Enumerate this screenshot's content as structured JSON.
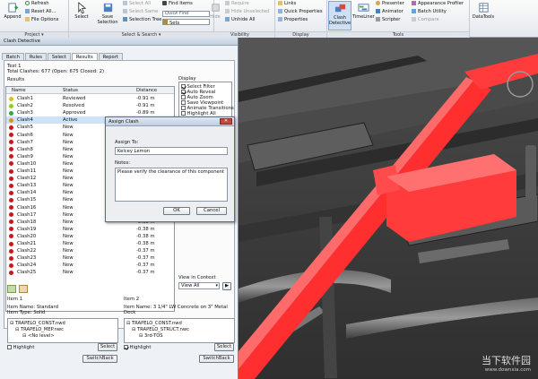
{
  "ribbon": {
    "project": {
      "label": "Project ▾",
      "append": "Append",
      "refresh": "Refresh",
      "reset_all": "Reset All...",
      "file_options": "File Options"
    },
    "select_search": {
      "label": "Select & Search ▾",
      "select": "Select",
      "save_selection": "Save Selection",
      "select_all": "Select All",
      "select_same": "Select Same",
      "selection_tree": "Selection Tree",
      "find_items": "Find Items",
      "quick_find_placeholder": "Quick Find",
      "sets": "Sets"
    },
    "visibility": {
      "label": "Visibility",
      "hide": "Hide",
      "require": "Require",
      "hide_unselected": "Hide Unselected",
      "unhide_all": "Unhide All"
    },
    "display": {
      "label": "Display",
      "links": "Links",
      "quick_properties": "Quick Properties",
      "properties": "Properties"
    },
    "tools": {
      "label": "Tools",
      "clash_detective": "Clash Detective",
      "timeliner": "TimeLiner",
      "presenter": "Presenter",
      "animator": "Animator",
      "scripter": "Scripter",
      "appearance_profiler": "Appearance Profiler",
      "batch_utility": "Batch Utility",
      "compare": "Compare",
      "datatools": "DataTools"
    }
  },
  "clash": {
    "window_title": "Clash Detective",
    "tabs": [
      "Batch",
      "Rules",
      "Select",
      "Results",
      "Report"
    ],
    "test_name": "Test 1",
    "summary": "Total Clashes: 677 (Open: 675  Closed: 2)",
    "results_label": "Results",
    "columns": {
      "name": "Name",
      "status": "Status",
      "distance": "Distance"
    },
    "rows": [
      {
        "name": "Clash1",
        "status": "Reviewed",
        "distance": "-0.91 m",
        "color": "#d9c21d"
      },
      {
        "name": "Clash2",
        "status": "Resolved",
        "distance": "-0.91 m",
        "color": "#8fcc2a"
      },
      {
        "name": "Clash3",
        "status": "Approved",
        "distance": "-0.89 m",
        "color": "#32a84a"
      },
      {
        "name": "Clash4",
        "status": "Active",
        "distance": "",
        "color": "#e09028"
      },
      {
        "name": "Clash5",
        "status": "New",
        "distance": "",
        "color": "#c8171a"
      },
      {
        "name": "Clash6",
        "status": "New",
        "distance": "",
        "color": "#c8171a"
      },
      {
        "name": "Clash7",
        "status": "New",
        "distance": "",
        "color": "#c8171a"
      },
      {
        "name": "Clash8",
        "status": "New",
        "distance": "",
        "color": "#c8171a"
      },
      {
        "name": "Clash9",
        "status": "New",
        "distance": "",
        "color": "#c8171a"
      },
      {
        "name": "Clash10",
        "status": "New",
        "distance": "",
        "color": "#c8171a"
      },
      {
        "name": "Clash11",
        "status": "New",
        "distance": "",
        "color": "#c8171a"
      },
      {
        "name": "Clash12",
        "status": "New",
        "distance": "",
        "color": "#c8171a"
      },
      {
        "name": "Clash13",
        "status": "New",
        "distance": "",
        "color": "#c8171a"
      },
      {
        "name": "Clash14",
        "status": "New",
        "distance": "",
        "color": "#c8171a"
      },
      {
        "name": "Clash15",
        "status": "New",
        "distance": "",
        "color": "#c8171a"
      },
      {
        "name": "Clash16",
        "status": "New",
        "distance": "",
        "color": "#c8171a"
      },
      {
        "name": "Clash17",
        "status": "New",
        "distance": "",
        "color": "#c8171a"
      },
      {
        "name": "Clash18",
        "status": "New",
        "distance": "-0.38 m",
        "color": "#c8171a"
      },
      {
        "name": "Clash19",
        "status": "New",
        "distance": "-0.38 m",
        "color": "#c8171a"
      },
      {
        "name": "Clash20",
        "status": "New",
        "distance": "-0.38 m",
        "color": "#c8171a"
      },
      {
        "name": "Clash21",
        "status": "New",
        "distance": "-0.38 m",
        "color": "#c8171a"
      },
      {
        "name": "Clash22",
        "status": "New",
        "distance": "-0.37 m",
        "color": "#c8171a"
      },
      {
        "name": "Clash23",
        "status": "New",
        "distance": "-0.37 m",
        "color": "#c8171a"
      },
      {
        "name": "Clash24",
        "status": "New",
        "distance": "-0.37 m",
        "color": "#c8171a"
      },
      {
        "name": "Clash25",
        "status": "New",
        "distance": "-0.37 m",
        "color": "#c8171a"
      }
    ],
    "display_label": "Display",
    "display_options": [
      {
        "label": "Select Filter",
        "checked": true
      },
      {
        "label": "Auto Reveal",
        "checked": true
      },
      {
        "label": "Auto Zoom",
        "checked": false
      },
      {
        "label": "Save Viewpoint",
        "checked": false
      },
      {
        "label": "Animate Transitions",
        "checked": false
      },
      {
        "label": "Highlight All",
        "checked": false
      }
    ],
    "view_in_context_label": "View in Context",
    "view_in_context_value": "View All",
    "item1": {
      "title": "Item 1",
      "item_name": "Item Name: Standard",
      "item_type": "Item Type: Solid",
      "tree": [
        "TRAPELO_CONST.nwd",
        "TRAPELO_MEP.nwc",
        "<No level>"
      ],
      "highlight": "Highlight",
      "select": "Select",
      "switchback": "SwitchBack"
    },
    "item2": {
      "title": "Item 2",
      "item_name": "Item Name: 3 1/4\" LW Concrete on 3\" Metal Deck",
      "tree": [
        "TRAPELO_CONST.nwd",
        "TRAPELO_STRUCT.nwc",
        "3rd-TOS"
      ],
      "highlight": "Highlight",
      "select": "Select",
      "switchback": "SwitchBack"
    }
  },
  "dialog": {
    "title": "Assign Clash",
    "assign_to_label": "Assign To:",
    "assign_to_value": "Kelcey Lemon",
    "notes_label": "Notes:",
    "notes_value": "Please verify the clearance of this component",
    "ok": "OK",
    "cancel": "Cancel"
  },
  "watermark": {
    "line1": "当下软件园",
    "line2": "www.downxia.com"
  },
  "colors": {
    "clash_highlight": "#ff3b3b",
    "ribbon_active": "#cfe0f5"
  }
}
